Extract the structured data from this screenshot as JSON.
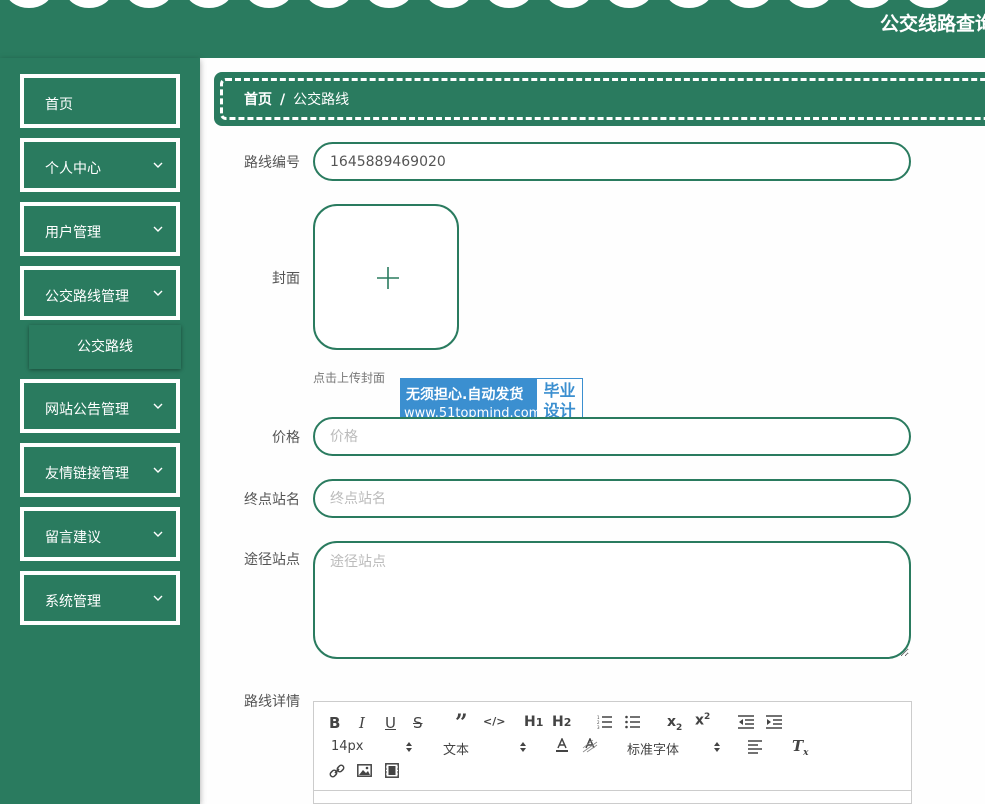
{
  "header": {
    "title": "公交线路查询"
  },
  "sidebar": {
    "items": [
      {
        "label": "首页"
      },
      {
        "label": "个人中心"
      },
      {
        "label": "用户管理"
      },
      {
        "label": "公交路线管理"
      },
      {
        "label": "网站公告管理"
      },
      {
        "label": "友情链接管理"
      },
      {
        "label": "留言建议"
      },
      {
        "label": "系统管理"
      }
    ],
    "submenu": {
      "label": "公交路线"
    }
  },
  "breadcrumb": {
    "home": "首页",
    "separator": "/",
    "current": "公交路线"
  },
  "form": {
    "route_no": {
      "label": "路线编号",
      "value": "1645889469020"
    },
    "cover": {
      "label": "封面",
      "hint": "点击上传封面"
    },
    "price": {
      "label": "价格",
      "placeholder": "价格"
    },
    "terminal": {
      "label": "终点站名",
      "placeholder": "终点站名"
    },
    "stops": {
      "label": "途径站点",
      "placeholder": "途径站点"
    },
    "details": {
      "label": "路线详情"
    }
  },
  "watermark": {
    "line1": "无须担心.自动发货",
    "line2": "www.51topmind.com",
    "badge_line1": "毕业",
    "badge_line2": "设计"
  },
  "editor": {
    "font_size": "14px",
    "header_select": "文本",
    "font_family": "标准字体",
    "tools": [
      "bold-icon",
      "italic-icon",
      "underline-icon",
      "strike-icon",
      "blockquote-icon",
      "code-block-icon",
      "h1-icon",
      "h2-icon",
      "ordered-list-icon",
      "bullet-list-icon",
      "subscript-icon",
      "superscript-icon",
      "outdent-icon",
      "indent-icon",
      "text-color-icon",
      "background-color-icon",
      "align-icon",
      "clean-format-icon",
      "link-icon",
      "image-icon",
      "video-icon"
    ]
  },
  "colors": {
    "primary": "#2a7b5f",
    "white": "#ffffff",
    "ad_blue": "#3b8fd0"
  }
}
